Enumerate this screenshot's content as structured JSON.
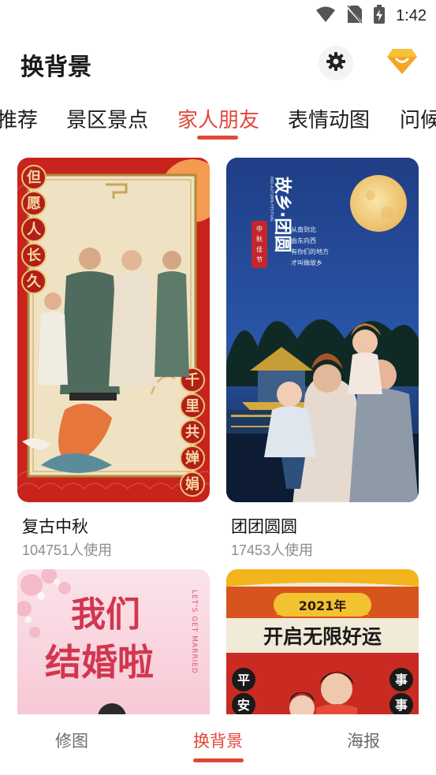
{
  "status": {
    "time": "1:42"
  },
  "app": {
    "title": "换背景"
  },
  "tabs": [
    {
      "label": "推荐",
      "active": false
    },
    {
      "label": "景区景点",
      "active": false
    },
    {
      "label": "家人朋友",
      "active": true
    },
    {
      "label": "表情动图",
      "active": false
    },
    {
      "label": "问候"
    }
  ],
  "cards": [
    {
      "name": "复古中秋",
      "usage": "104751人使用",
      "poster_text": {
        "left_vertical": [
          "但",
          "愿",
          "人",
          "长",
          "久"
        ],
        "right_vertical": [
          "千",
          "里",
          "共",
          "婵",
          "娟"
        ]
      }
    },
    {
      "name": "团团圆圆",
      "usage": "17453人使用",
      "poster_text": {
        "title": "故乡·团圆",
        "stamp": [
          "中",
          "秋",
          "佳",
          "节"
        ],
        "subtitle_en": "MID-AUTUMN FESTIVAL",
        "lines": [
          "从南到北",
          "由东向西",
          "有你们的地方",
          "才叫做故乡"
        ]
      }
    },
    {
      "poster_text": {
        "title_line1": "我们",
        "title_line2": "结婚啦",
        "vertical_en": "LET'S GET MARRIED"
      }
    },
    {
      "poster_text": {
        "year": "2021年",
        "headline": "开启无限好运",
        "left_vertical": [
          "平",
          "安"
        ],
        "right_vertical": [
          "事",
          "事"
        ]
      }
    }
  ],
  "bottom_nav": [
    {
      "label": "修图",
      "active": false
    },
    {
      "label": "换背景",
      "active": true
    },
    {
      "label": "海报",
      "active": false
    }
  ],
  "colors": {
    "accent": "#e2473a",
    "title": "#1a1a1a",
    "muted": "#8c8c8c"
  },
  "icons": [
    "wifi-icon",
    "no-sim-icon",
    "battery-charging-icon",
    "settings-gear-icon",
    "vip-diamond-icon"
  ]
}
